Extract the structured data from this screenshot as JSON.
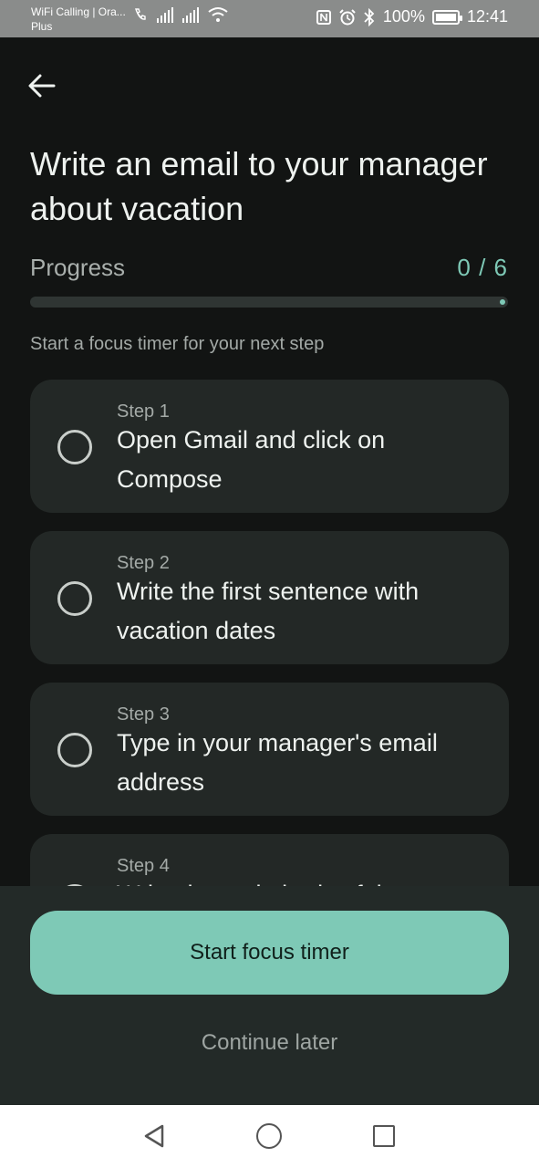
{
  "status_bar": {
    "carrier_line1": "WiFi Calling | Ora...",
    "carrier_line2": "Plus",
    "battery": "100%",
    "time": "12:41",
    "icons": [
      "wifi-calling-icon",
      "signal-icon",
      "signal-icon",
      "wifi-icon",
      "nfc-icon",
      "alarm-icon",
      "bluetooth-icon",
      "battery-icon"
    ]
  },
  "header": {
    "back_icon": "arrow-left-icon",
    "title": "Write an email to your manager about vacation"
  },
  "progress": {
    "label": "Progress",
    "count": "0 / 6",
    "completed": 0,
    "total": 6
  },
  "hint": "Start a focus timer for your next step",
  "steps": [
    {
      "num": "Step 1",
      "text": "Open Gmail and click on Compose"
    },
    {
      "num": "Step 2",
      "text": "Write the first sentence with vacation dates"
    },
    {
      "num": "Step 3",
      "text": "Type in your manager's email address"
    },
    {
      "num": "Step 4",
      "text": "Write the main body of the"
    }
  ],
  "actions": {
    "primary": "Start focus timer",
    "secondary": "Continue later"
  },
  "colors": {
    "background": "#121413",
    "card": "#232826",
    "accent": "#7ec9b6",
    "sheet": "#232a28"
  }
}
